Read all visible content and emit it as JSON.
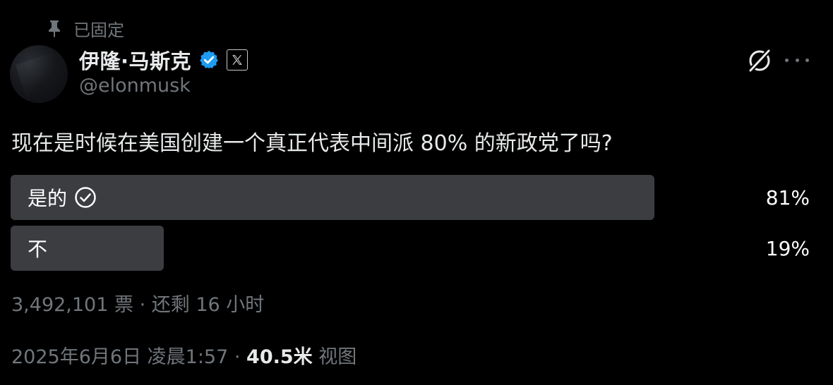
{
  "pinned": {
    "label": "已固定",
    "icon": "pin-icon"
  },
  "author": {
    "display_name": "伊隆·马斯克",
    "handle": "@elonmusk",
    "verified": true,
    "verified_color": "#1d9bf0",
    "affiliate_badge": "x-logo-icon"
  },
  "header_actions": {
    "grok_icon": "grok-icon",
    "more_icon": "more-icon"
  },
  "tweet": {
    "text": "现在是时候在美国创建一个真正代表中间派 80% 的新政党了吗?"
  },
  "poll": {
    "options": [
      {
        "label": "是的",
        "percent_label": "81%",
        "percent": 81,
        "selected": true,
        "bar_fraction": 0.8
      },
      {
        "label": "不",
        "percent_label": "19%",
        "percent": 19,
        "selected": false,
        "bar_fraction": 0.19
      }
    ],
    "footer": "3,492,101 票 · 还剩 16 小时",
    "bar_color": "#3b3d41"
  },
  "meta": {
    "timestamp": "2025年6月6日 凌晨1:57",
    "separator": " · ",
    "views_count": "40.5米",
    "views_label": " 视图"
  },
  "colors": {
    "background": "#000000",
    "primary_text": "#e7e9ea",
    "secondary_text": "#71767b"
  }
}
